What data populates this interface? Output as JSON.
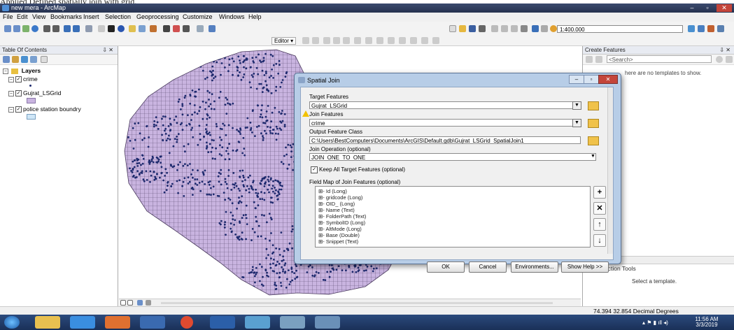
{
  "caption": "Applied Defined spatially join with grid.",
  "window": {
    "title": "new mera - ArcMap",
    "min": "–",
    "max": "▫",
    "close": "✕"
  },
  "menu": [
    "File",
    "Edit",
    "View",
    "Bookmarks",
    "Insert",
    "Selection",
    "Geoprocessing",
    "Customize",
    "Windows",
    "Help"
  ],
  "toolbar": {
    "scale": "1:400.000",
    "editor_label": "Editor ▾"
  },
  "toc": {
    "title": "Table Of Contents",
    "pin": "⇩ ✕",
    "root": "Layers",
    "layers": [
      {
        "name": "crime",
        "checked": true
      },
      {
        "name": "Gujrat_LSGrid",
        "checked": true
      },
      {
        "name": "police station boundry",
        "checked": true
      }
    ]
  },
  "right_panel": {
    "title": "Create Features",
    "pin": "⇩ ✕",
    "search_placeholder": "<Search>",
    "no_templates": "here are no templates to show.",
    "construction_title": "Construction Tools",
    "select_template": "Select a template."
  },
  "status": {
    "coords": "74.394  32.854 Decimal Degrees"
  },
  "taskbar": {
    "time": "11:56 AM",
    "date": "3/3/2019"
  },
  "dialog": {
    "title": "Spatial Join",
    "target_label": "Target Features",
    "target_value": "Gujrat_LSGrid",
    "join_label": "Join Features",
    "join_value": "crime",
    "output_label": "Output Feature Class",
    "output_value": "C:\\Users\\BestComputers\\Documents\\ArcGIS\\Default.gdb\\Gujrat_LSGrid_SpatialJoin1",
    "operation_label": "Join Operation (optional)",
    "operation_value": "JOIN_ONE_TO_ONE",
    "keep_label": "Keep All Target Features (optional)",
    "keep_checked": true,
    "fieldmap_label": "Field Map of Join Features (optional)",
    "fields": [
      "Id (Long)",
      "gridcode (Long)",
      "OID_ (Long)",
      "Name (Text)",
      "FolderPath (Text)",
      "SymbolID (Long)",
      "AltMode (Long)",
      "Base (Double)",
      "Snippet (Text)"
    ],
    "buttons": {
      "ok": "OK",
      "cancel": "Cancel",
      "env": "Environments...",
      "help": "Show Help >>"
    }
  },
  "colors": {
    "grid_fill": "#c9b4e0",
    "grid_line": "#5a4a6e",
    "points": "#1e2a6e",
    "dialog_frame": "#b7cde7"
  }
}
